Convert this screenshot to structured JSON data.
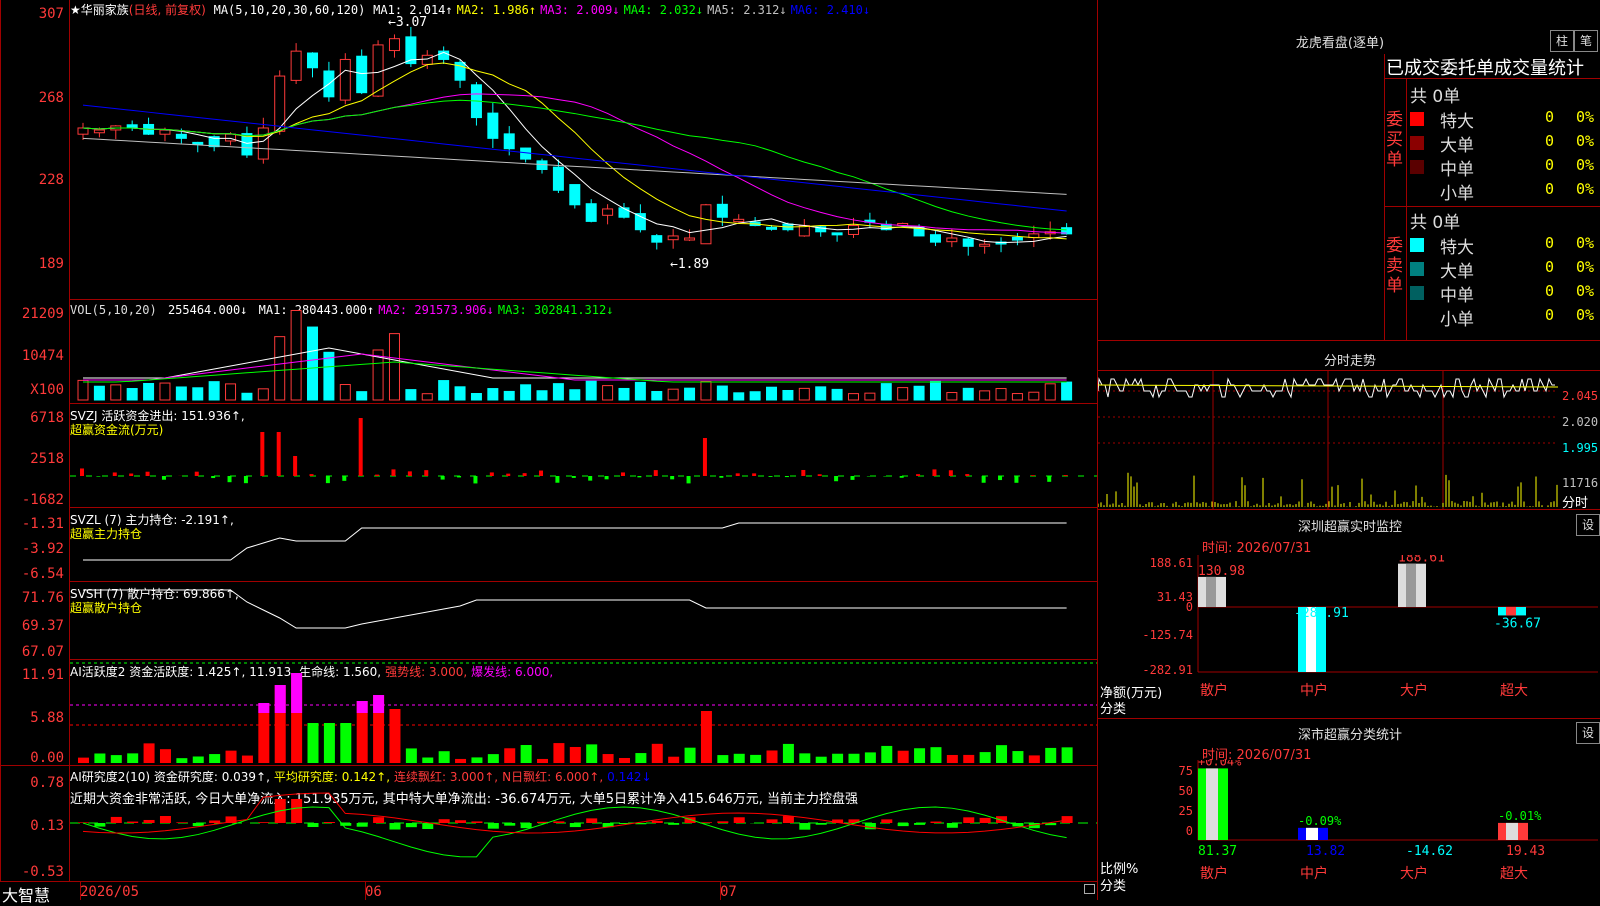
{
  "stock": {
    "star": "★",
    "name": "华丽家族",
    "mode": "(日线, 前复权)"
  },
  "price_panel": {
    "ma_title": "MA(5,10,20,30,60,120)",
    "ma": [
      {
        "label": "MA1: 2.014↑",
        "color": "#ffffff"
      },
      {
        "label": "MA2: 1.986↑",
        "color": "#ffff00"
      },
      {
        "label": "MA3: 2.009↓",
        "color": "#ff00ff"
      },
      {
        "label": "MA4: 2.032↓",
        "color": "#00ff00"
      },
      {
        "label": "MA5: 2.312↓",
        "color": "#c0c0c0"
      },
      {
        "label": "MA6: 2.410↓",
        "color": "#0000ff"
      }
    ],
    "yticks": [
      "307",
      "268",
      "228",
      "189"
    ],
    "high_label": "3.07",
    "low_label": "1.89"
  },
  "vol_panel": {
    "title": "VOL(5,10,20)",
    "value": "255464.000↓",
    "ma": [
      {
        "label": "MA1: 280443.000↑",
        "color": "#ffffff"
      },
      {
        "label": "MA2: 291573.906↓",
        "color": "#ff00ff"
      },
      {
        "label": "MA3: 302841.312↓",
        "color": "#00ff00"
      }
    ],
    "yticks": [
      "21209",
      "10474",
      "X100"
    ]
  },
  "svzj_panel": {
    "title": "SVZJ  活跃资金进出: 151.936↑,",
    "subtitle": "超赢资金流(万元)",
    "yticks": [
      "6718",
      "2518",
      "-1682"
    ]
  },
  "svzl_panel": {
    "title": "SVZL (7) 主力持仓: -2.191↑,",
    "subtitle": "超赢主力持仓",
    "yticks": [
      "-1.31",
      "-3.92",
      "-6.54"
    ]
  },
  "svsh_panel": {
    "title": "SVSH (7) 散户持仓: 69.866↑,",
    "subtitle": "超赢散户持仓",
    "yticks": [
      "71.76",
      "69.37",
      "67.07"
    ]
  },
  "ai_active_panel": {
    "title": "AI活跃度2 资金活跃度: 1.425↑,",
    "v2": "11.913,",
    "v3": "生命线: 1.560,",
    "v4": "强势线: 3.000,",
    "v5": "爆发线: 6.000,",
    "yticks": [
      "11.91",
      "5.88",
      "0.00"
    ]
  },
  "ai_research_panel": {
    "title": "AI研究度2(10) 资金研究度: 0.039↑,",
    "v2": "平均研究度: 0.142↑,",
    "v3": "连续飘红: 3.000↑,",
    "v4": "N日飘红: 6.000↑,",
    "v5": "0.142↓",
    "comment": "近期大资金非常活跃, 今日大单净流入: 151.935万元, 其中特大单净流出: -36.674万元, 大单5日累计净入415.646万元, 当前主力控盘强",
    "yticks": [
      "0.78",
      "0.13",
      "-0.53"
    ]
  },
  "xaxis": {
    "brand": "大智慧",
    "labels": [
      "2026/05",
      "06",
      "07"
    ]
  },
  "longhu": {
    "title": "龙虎看盘(逐单)",
    "btn1": "柱",
    "btn2": "笔",
    "subtitle": "已成交委托单成交量统计",
    "buy_side": "委买单",
    "sell_side": "委卖单",
    "buy_total": "共 0单",
    "sell_total": "共 0单",
    "buy_rows": [
      {
        "name": "特大",
        "count": "0",
        "pct": "0%",
        "color": "#ff0000"
      },
      {
        "name": "大单",
        "count": "0",
        "pct": "0%",
        "color": "#8b0000"
      },
      {
        "name": "中单",
        "count": "0",
        "pct": "0%",
        "color": "#5a0000"
      },
      {
        "name": "小单",
        "count": "0",
        "pct": "0%",
        "color": "#000000"
      }
    ],
    "sell_rows": [
      {
        "name": "特大",
        "count": "0",
        "pct": "0%",
        "color": "#00ffff"
      },
      {
        "name": "大单",
        "count": "0",
        "pct": "0%",
        "color": "#008080"
      },
      {
        "name": "中单",
        "count": "0",
        "pct": "0%",
        "color": "#006060"
      },
      {
        "name": "小单",
        "count": "0",
        "pct": "0%",
        "color": "#000000"
      }
    ]
  },
  "intraday": {
    "title": "分时走势",
    "yticks": [
      "2.045",
      "2.020",
      "1.995"
    ],
    "vol_label": "11716",
    "vol_sub": "分时"
  },
  "sz_monitor": {
    "title": "深圳超赢实时监控",
    "btn": "设",
    "time": "时间: 2026/07/31",
    "yticks": [
      "188.61",
      "31.43",
      "0",
      "-125.74",
      "-282.91"
    ],
    "ylabel": "净额(万元)",
    "xlabel": "分类",
    "bars": [
      {
        "cat": "散户",
        "value": "130.98"
      },
      {
        "cat": "中户",
        "value": "-282.91"
      },
      {
        "cat": "大户",
        "value": "188.61"
      },
      {
        "cat": "超大",
        "value": "-36.67"
      }
    ]
  },
  "sz_stats": {
    "title": "深市超赢分类统计",
    "btn": "设",
    "time": "时间: 2026/07/31",
    "yticks": [
      "75",
      "50",
      "25",
      "0"
    ],
    "ylabel": "比例%",
    "xlabel": "分类",
    "bars": [
      {
        "cat": "散户",
        "pct": "+0.04%",
        "value": "81.37"
      },
      {
        "cat": "中户",
        "pct": "-0.09%",
        "value": "13.82"
      },
      {
        "cat": "大户",
        "pct": "",
        "value": "-14.62"
      },
      {
        "cat": "超大",
        "pct": "-0.01%",
        "value": "19.43"
      }
    ]
  }
}
